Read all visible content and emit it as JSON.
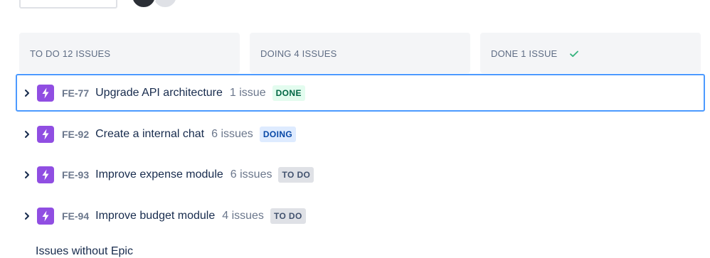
{
  "columns": [
    {
      "label": "TO DO 12 ISSUES"
    },
    {
      "label": "DOING 4 ISSUES"
    },
    {
      "label": "DONE 1 ISSUE"
    }
  ],
  "epics": [
    {
      "key": "FE-77",
      "summary": "Upgrade API architecture",
      "count": "1 issue",
      "status": "DONE"
    },
    {
      "key": "FE-92",
      "summary": "Create a internal chat",
      "count": "6 issues",
      "status": "DOING"
    },
    {
      "key": "FE-93",
      "summary": "Improve expense module",
      "count": "6 issues",
      "status": "TO DO"
    },
    {
      "key": "FE-94",
      "summary": "Improve budget module",
      "count": "4 issues",
      "status": "TO DO"
    }
  ],
  "bottom": {
    "text": "Issues without Epic"
  },
  "colors": {
    "epic": "#904ee2",
    "selected_border": "#4c9aff",
    "done_check": "#36b37e"
  },
  "icons": {
    "check": "check-icon",
    "chevron": "chevron-right-icon",
    "epic": "lightning-bolt-icon"
  }
}
